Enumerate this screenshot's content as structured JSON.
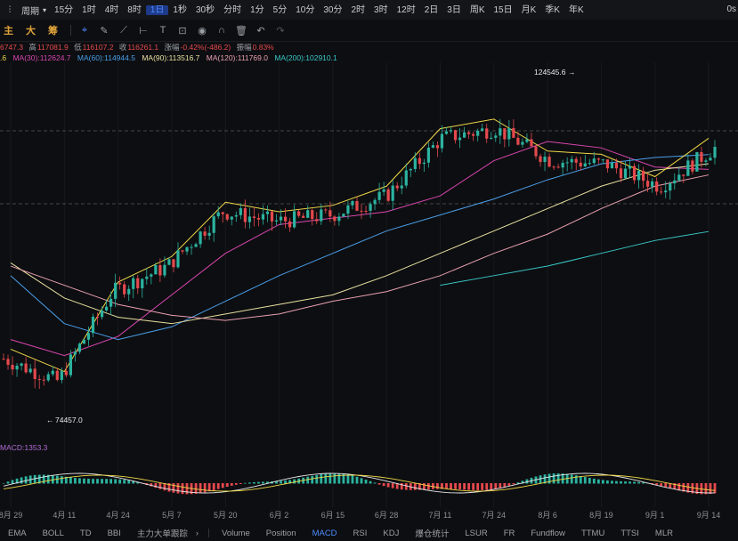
{
  "topbar": {
    "period_label": "周期",
    "timeframes": [
      "15分",
      "1时",
      "4时",
      "8时",
      "1日",
      "1秒",
      "30秒",
      "分时",
      "1分",
      "5分",
      "10分",
      "30分",
      "2时",
      "3时",
      "12时",
      "2日",
      "3日",
      "周K",
      "15日",
      "月K",
      "季K",
      "年K"
    ],
    "active_timeframe": "1日",
    "right_text": "0s"
  },
  "toolbar": {
    "chips": [
      "主",
      "大",
      "筹"
    ]
  },
  "ohlc": {
    "open": "6747.3",
    "high_label": "高",
    "high": "117081.9",
    "low_label": "低",
    "low": "116107.2",
    "close_label": "收",
    "close": "116261.1",
    "change_label": "涨幅",
    "change": "-0.42%(-486.2)",
    "amp_label": "振幅",
    "amp": "0.83%"
  },
  "ma_legend": [
    {
      "label": ".6",
      "color": "#f0d848"
    },
    {
      "label": "MA(30):112624.7",
      "color": "#d946b0"
    },
    {
      "label": "MA(60):114944.5",
      "color": "#4a9ee8"
    },
    {
      "label": "MA(90):113516.7",
      "color": "#e8e0a0"
    },
    {
      "label": "MA(120):111769.0",
      "color": "#e8a0b0"
    },
    {
      "label": "MA(200):102910.1",
      "color": "#38c8c8"
    }
  ],
  "colors": {
    "up": "#2bb3a0",
    "down": "#e5494d"
  },
  "annotations": {
    "high": "124545.6",
    "low": "74457.0"
  },
  "macd_label": "MACD:1353.3",
  "x_ticks": [
    "8月 29",
    "4月 11",
    "4月 24",
    "5月 7",
    "5月 20",
    "6月 2",
    "6月 15",
    "6月 28",
    "7月 11",
    "7月 24",
    "8月 6",
    "8月 19",
    "9月 1",
    "9月 14"
  ],
  "bottom_tabs": [
    "EMA",
    "BOLL",
    "TD",
    "BBI",
    "主力大单跟踪",
    "Volume",
    "Position",
    "MACD",
    "RSI",
    "KDJ",
    "爆仓统计",
    "LSUR",
    "FR",
    "Fundflow",
    "TTMU",
    "TTSI",
    "MLR"
  ],
  "active_bottom_tab": "MACD",
  "chart_data": {
    "type": "candlestick",
    "x": [
      "8月 29",
      "4月 11",
      "4月 24",
      "5月 7",
      "5月 20",
      "6月 2",
      "6月 15",
      "6月 28",
      "7月 11",
      "7月 24",
      "8月 6",
      "8月 19",
      "9月 1",
      "9月 14"
    ],
    "close": [
      83000,
      79500,
      93500,
      97500,
      106000,
      104500,
      105500,
      108500,
      117500,
      119000,
      114000,
      113500,
      110000,
      116000
    ],
    "series": [
      {
        "name": "MA(30)",
        "values": [
          86000,
          83500,
          86500,
          93000,
          99500,
          104000,
          105000,
          106000,
          108500,
          114000,
          117000,
          116000,
          113000,
          112624.7
        ]
      },
      {
        "name": "MA(60)",
        "values": [
          96000,
          88500,
          86000,
          88000,
          92000,
          96000,
          99500,
          103000,
          105500,
          108000,
          111000,
          113500,
          114500,
          114944.5
        ]
      },
      {
        "name": "MA(90)",
        "values": [
          98000,
          92500,
          89500,
          88500,
          90000,
          91500,
          93000,
          96000,
          99500,
          103000,
          106500,
          110000,
          112500,
          113516.7
        ]
      },
      {
        "name": "MA(120)",
        "values": [
          97500,
          94500,
          91500,
          89800,
          89000,
          90000,
          92000,
          93500,
          96000,
          99500,
          102500,
          106500,
          110000,
          111769.0
        ]
      },
      {
        "name": "MA(200)",
        "values": [
          null,
          null,
          null,
          null,
          null,
          null,
          null,
          null,
          94500,
          96000,
          97500,
          99500,
          101500,
          102910.1
        ]
      }
    ],
    "ylim": [
      73000,
      128000
    ],
    "annotations": [
      {
        "x": "8月 11",
        "y": 124545.6,
        "text": "124545.6"
      },
      {
        "x": "4月 9",
        "y": 74457.0,
        "text": "74457.0"
      }
    ]
  }
}
